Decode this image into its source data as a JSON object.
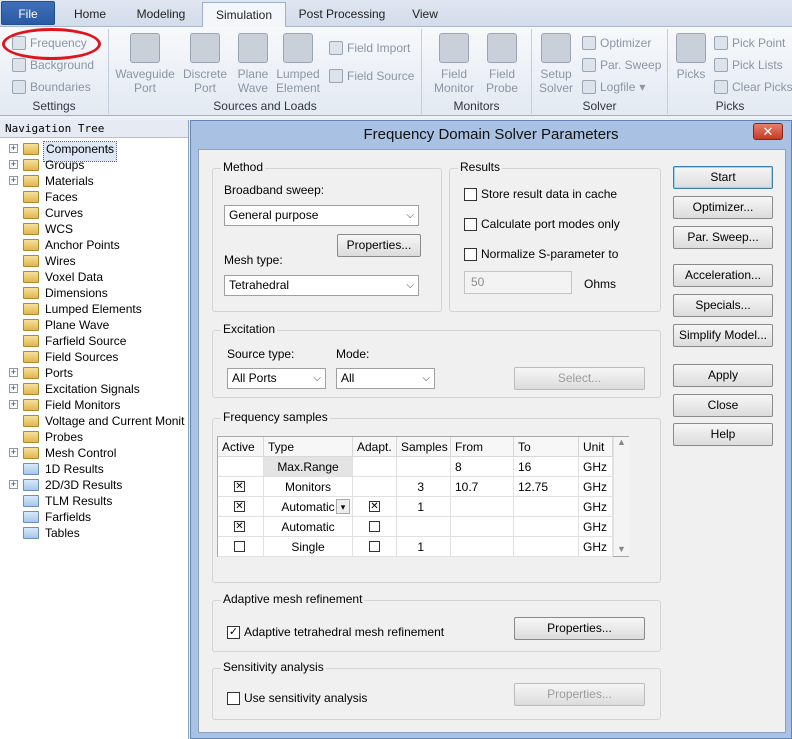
{
  "tabs": [
    "File",
    "Home",
    "Modeling",
    "Simulation",
    "Post Processing",
    "View"
  ],
  "ribbon": {
    "settings": {
      "label": "Settings",
      "items": [
        "Frequency",
        "Background",
        "Boundaries"
      ]
    },
    "sources": {
      "label": "Sources and Loads",
      "large": [
        "Waveguide Port",
        "Discrete Port",
        "Plane Wave",
        "Lumped Element"
      ],
      "small": [
        "Field Import",
        "Field Source"
      ]
    },
    "monitors": {
      "label": "Monitors",
      "large": [
        "Field Monitor",
        "Field Probe"
      ]
    },
    "solver": {
      "label": "Solver",
      "large": "Setup Solver",
      "small": [
        "Optimizer",
        "Par. Sweep",
        "Logfile"
      ]
    },
    "picks": {
      "label": "Picks",
      "large": "Picks",
      "small": [
        "Pick Point",
        "Pick Lists",
        "Clear Picks"
      ]
    }
  },
  "nav": {
    "title": "Navigation Tree",
    "items": [
      {
        "label": "Components",
        "exp": true,
        "res": false
      },
      {
        "label": "Groups",
        "exp": true,
        "res": false
      },
      {
        "label": "Materials",
        "exp": true,
        "res": false
      },
      {
        "label": "Faces",
        "exp": false,
        "res": false
      },
      {
        "label": "Curves",
        "exp": false,
        "res": false
      },
      {
        "label": "WCS",
        "exp": false,
        "res": false
      },
      {
        "label": "Anchor Points",
        "exp": false,
        "res": false
      },
      {
        "label": "Wires",
        "exp": false,
        "res": false
      },
      {
        "label": "Voxel Data",
        "exp": false,
        "res": false
      },
      {
        "label": "Dimensions",
        "exp": false,
        "res": false
      },
      {
        "label": "Lumped Elements",
        "exp": false,
        "res": false
      },
      {
        "label": "Plane Wave",
        "exp": false,
        "res": false
      },
      {
        "label": "Farfield Source",
        "exp": false,
        "res": false
      },
      {
        "label": "Field Sources",
        "exp": false,
        "res": false
      },
      {
        "label": "Ports",
        "exp": true,
        "res": false
      },
      {
        "label": "Excitation Signals",
        "exp": true,
        "res": false
      },
      {
        "label": "Field Monitors",
        "exp": true,
        "res": false
      },
      {
        "label": "Voltage and Current Monit",
        "exp": false,
        "res": false
      },
      {
        "label": "Probes",
        "exp": false,
        "res": false
      },
      {
        "label": "Mesh Control",
        "exp": true,
        "res": false
      },
      {
        "label": "1D Results",
        "exp": false,
        "res": true
      },
      {
        "label": "2D/3D Results",
        "exp": true,
        "res": true
      },
      {
        "label": "TLM Results",
        "exp": false,
        "res": true
      },
      {
        "label": "Farfields",
        "exp": false,
        "res": true
      },
      {
        "label": "Tables",
        "exp": false,
        "res": true
      }
    ]
  },
  "dialog": {
    "title": "Frequency Domain Solver Parameters",
    "close": "✕",
    "method": {
      "legend": "Method",
      "broadband_label": "Broadband sweep:",
      "broadband_value": "General purpose",
      "properties": "Properties...",
      "mesh_label": "Mesh type:",
      "mesh_value": "Tetrahedral"
    },
    "results": {
      "legend": "Results",
      "store": "Store result data in cache",
      "port": "Calculate port modes only",
      "normalize": "Normalize S-parameter to",
      "ohms_value": "50",
      "ohms_unit": "Ohms"
    },
    "excitation": {
      "legend": "Excitation",
      "source_label": "Source type:",
      "source_value": "All Ports",
      "mode_label": "Mode:",
      "mode_value": "All",
      "select": "Select..."
    },
    "freq": {
      "legend": "Frequency samples",
      "headers": [
        "Active",
        "Type",
        "Adapt.",
        "Samples",
        "From",
        "To",
        "Unit"
      ],
      "rows": [
        {
          "active": "",
          "type": "Max.Range",
          "adapt": "",
          "samples": "",
          "from": "8",
          "to": "16",
          "unit": "GHz"
        },
        {
          "active": "x",
          "type": "Monitors",
          "adapt": "",
          "samples": "3",
          "from": "10.7",
          "to": "12.75",
          "unit": "GHz"
        },
        {
          "active": "x",
          "type": "Automatic",
          "adapt": "x",
          "samples": "1",
          "from": "",
          "to": "",
          "unit": "GHz"
        },
        {
          "active": "x",
          "type": "Automatic",
          "adapt": "o",
          "samples": "",
          "from": "",
          "to": "",
          "unit": "GHz"
        },
        {
          "active": "o",
          "type": "Single",
          "adapt": "o",
          "samples": "1",
          "from": "",
          "to": "",
          "unit": "GHz"
        }
      ]
    },
    "adaptive": {
      "legend": "Adaptive mesh refinement",
      "check": "Adaptive tetrahedral mesh refinement",
      "properties": "Properties..."
    },
    "sensitivity": {
      "legend": "Sensitivity analysis",
      "check": "Use sensitivity analysis",
      "properties": "Properties..."
    },
    "buttons": [
      "Start",
      "Optimizer...",
      "Par. Sweep...",
      "Acceleration...",
      "Specials...",
      "Simplify Model...",
      "Apply",
      "Close",
      "Help"
    ]
  }
}
